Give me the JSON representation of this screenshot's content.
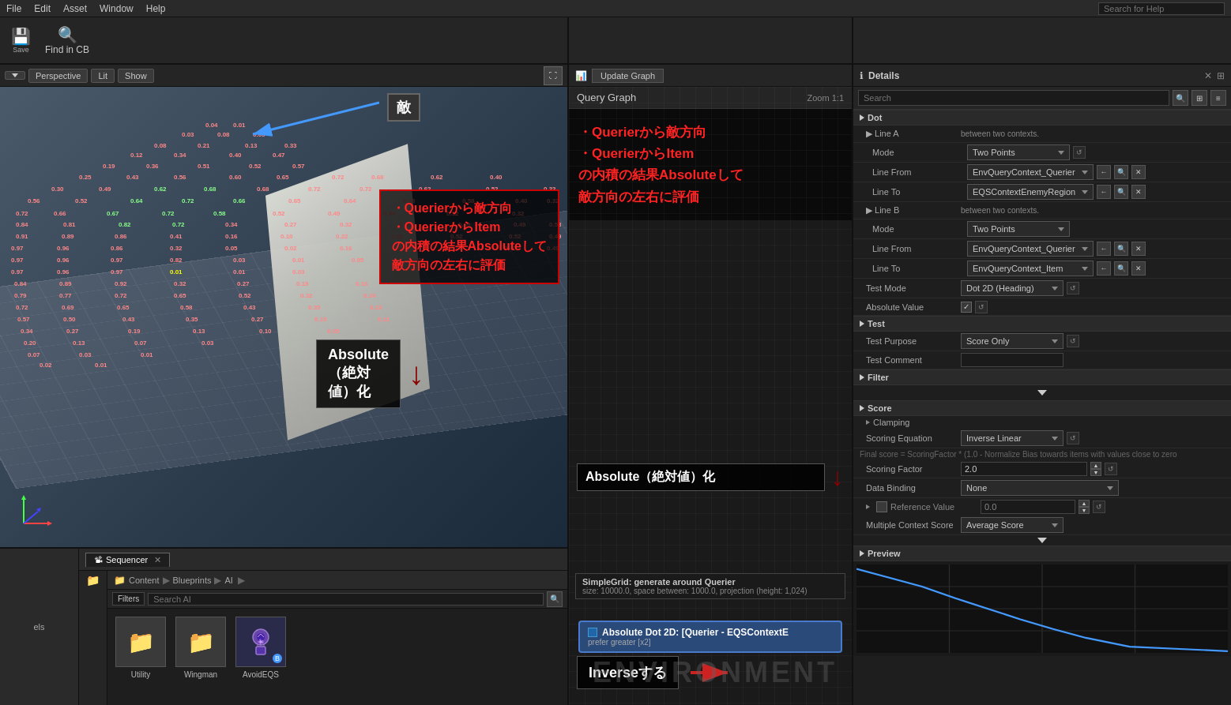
{
  "topMenu": {
    "items": [
      "File",
      "Edit",
      "Asset",
      "Window",
      "Help"
    ],
    "searchPlaceholder": "Search for Help"
  },
  "toolbar": {
    "save_label": "Save",
    "findInCB_label": "Find in CB"
  },
  "viewport": {
    "perspective_label": "Perspective",
    "lit_label": "Lit",
    "show_label": "Show",
    "annotation_line1": "・Querierから敵方向",
    "annotation_line2": "・QuerierからItem",
    "annotation_line3": "の内積の結果Absoluteして",
    "annotation_line4": "敵方向の左右に評価",
    "absolute_label": "Absolute（絶対値）化",
    "inverse_label": "Inverseする"
  },
  "eqsPanel": {
    "toolbar_label": "Update Graph",
    "graph_title": "Query Graph",
    "zoom_label": "Zoom 1:1",
    "simple_grid_title": "SimpleGrid: generate around Querier",
    "simple_grid_sub": "size: 10000.0, space between: 1000.0, projection (height: 1,024)",
    "node_title": "Absolute Dot 2D: [Querier - EQSContextE",
    "node_subtitle": "prefer greater [x2]",
    "env_watermark": "ENVIRONMENT"
  },
  "details": {
    "title": "Details",
    "search_placeholder": "Search",
    "sections": {
      "dot": {
        "label": "Dot",
        "lineA": {
          "label": "Line A",
          "between_label": "between two contexts.",
          "mode_label": "Mode",
          "mode_value": "Two Points",
          "from_label": "Line From",
          "from_value": "EnvQueryContext_Querier",
          "to_label": "Line To",
          "to_value": "EQSContextEnemyRegion"
        },
        "lineB": {
          "label": "Line B",
          "between_label": "between two contexts.",
          "mode_label": "Mode",
          "mode_value": "Two Points",
          "from_label": "Line From",
          "from_value": "EnvQueryContext_Querier",
          "to_label": "Line To",
          "to_value": "EnvQueryContext_Item"
        },
        "testMode_label": "Test Mode",
        "testMode_value": "Dot 2D (Heading)",
        "absValue_label": "Absolute Value"
      },
      "test": {
        "label": "Test",
        "purpose_label": "Test Purpose",
        "purpose_value": "Score Only",
        "comment_label": "Test Comment",
        "comment_value": ""
      },
      "filter": {
        "label": "Filter"
      },
      "score": {
        "label": "Score",
        "clamping_label": "Clamping",
        "equation_label": "Scoring Equation",
        "equation_value": "Inverse Linear",
        "hint": "Final score = ScoringFactor * (1.0 - Normalize\nBias towards items with values close to zero",
        "factor_label": "Scoring Factor",
        "factor_value": "2.0",
        "binding_label": "Data Binding",
        "binding_value": "None",
        "ref_label": "Reference Value",
        "ref_value": "0.0",
        "multiple_label": "Multiple Context Score",
        "multiple_value": "Average Score"
      },
      "preview": {
        "label": "Preview"
      }
    }
  },
  "contentBrowser": {
    "levels_label": "els",
    "sequencer_label": "Sequencer",
    "breadcrumb": [
      "Content",
      "Blueprints",
      "AI"
    ],
    "filters_label": "Filters",
    "search_placeholder": "Search AI",
    "assets": [
      {
        "name": "Utility",
        "type": "folder"
      },
      {
        "name": "Wingman",
        "type": "folder"
      },
      {
        "name": "AvoidEQS",
        "type": "ai"
      }
    ]
  }
}
